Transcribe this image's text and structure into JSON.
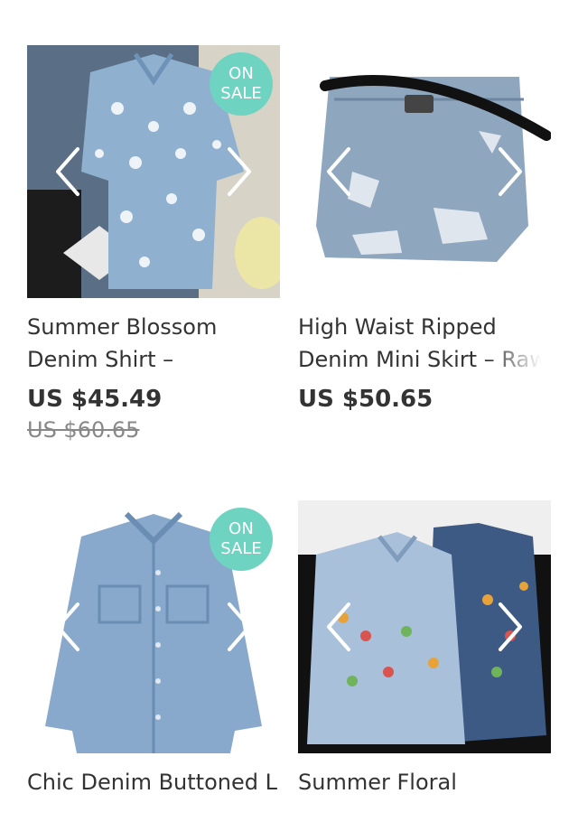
{
  "products": [
    {
      "title": "Summer Blossom Denim Shirt –",
      "price": "US $45.49",
      "old_price": "US $60.65",
      "badge": {
        "line1": "ON",
        "line2": "SALE"
      }
    },
    {
      "title": "High Waist Ripped Denim Mini Skirt – Raw",
      "price": "US $50.65"
    },
    {
      "title": "Chic Denim Buttoned L",
      "badge": {
        "line1": "ON",
        "line2": "SALE"
      }
    },
    {
      "title": "Summer Floral"
    }
  ],
  "colors": {
    "badge": "#6fd3c1",
    "text": "#333333",
    "old_price": "#888888",
    "denim_light": "#8fb0cf",
    "denim_dark": "#3d5a85"
  },
  "icons": [
    "chevron-left-icon",
    "chevron-right-icon"
  ]
}
